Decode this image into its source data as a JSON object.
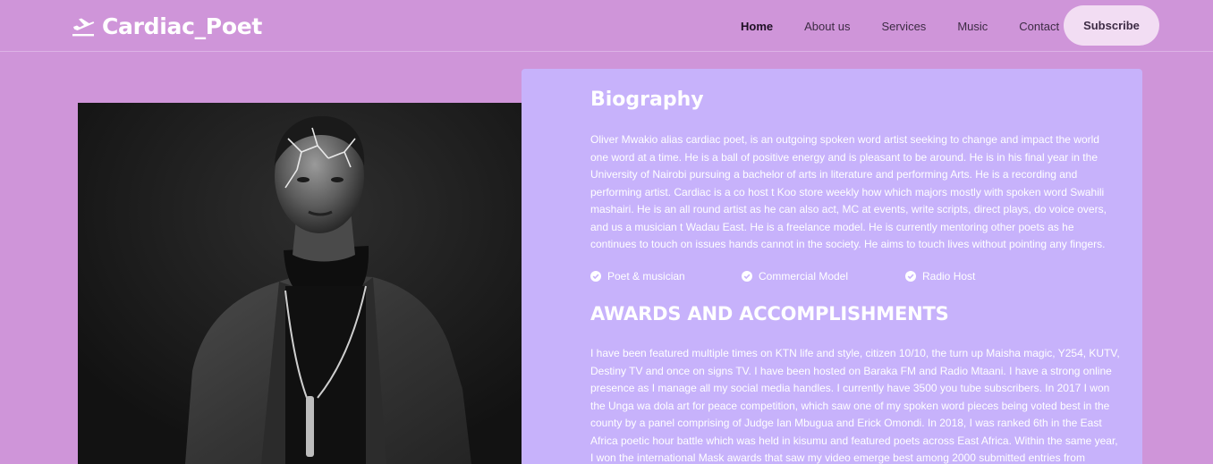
{
  "brand": {
    "name": "Cardiac_Poet",
    "icon": "airplane-takeoff-icon"
  },
  "nav": {
    "items": [
      {
        "label": "Home",
        "active": true
      },
      {
        "label": "About us",
        "active": false
      },
      {
        "label": "Services",
        "active": false
      },
      {
        "label": "Music",
        "active": false
      },
      {
        "label": "Contact",
        "active": false
      }
    ],
    "subscribe_label": "Subscribe"
  },
  "photo": {
    "icon": "portrait-photo"
  },
  "biography": {
    "title": "Biography",
    "text": "Oliver Mwakio alias cardiac poet, is an outgoing spoken word artist seeking to change and impact the world one word at a time. He is a ball of positive energy and is pleasant to be around. He is in his final year in the University of Nairobi pursuing a bachelor of arts in literature and performing Arts. He is a recording and performing artist. Cardiac is a co host t Koo store weekly how which majors mostly with spoken word Swahili mashairi. He is an all round artist as he can also act, MC at events, write scripts, direct plays, do voice overs, and us a musician t Wadau East. He is a freelance model. He is currently mentoring other poets as he continues to touch on issues hands cannot in the society. He aims to touch lives without pointing any fingers.",
    "tags": [
      {
        "label": "Poet & musician",
        "icon": "check-circle-icon"
      },
      {
        "label": "Commercial Model",
        "icon": "check-circle-icon"
      },
      {
        "label": "Radio Host",
        "icon": "check-circle-icon"
      }
    ]
  },
  "awards": {
    "title": "AWARDS AND ACCOMPLISHMENTS",
    "text": "I have been featured multiple times on KTN life and style, citizen 10/10, the turn up Maisha magic, Y254, KUTV, Destiny TV and once on signs TV. I have been hosted on Baraka FM and Radio Mtaani. I have a strong online presence as I manage all my social media handles. I currently have 3500 you tube subscribers. In 2017 I won the Unga wa dola art for peace competition, which saw one of my spoken word pieces being voted best in the county by a panel comprising of Judge Ian Mbugua and Erick Omondi. In 2018, I was ranked 6th in the East Africa poetic hour battle which was held in kisumu and featured poets across East Africa. Within the same year, I won the international Mask awards that saw my video emerge best among 2000 submitted entries from Kenya, Uganda,"
  },
  "colors": {
    "page_bg": "#cf95d9",
    "card_bg": "#c7b2fb",
    "button_bg": "#f2ddf3",
    "text_light": "#ffffff",
    "nav_text": "#3d2b44"
  }
}
